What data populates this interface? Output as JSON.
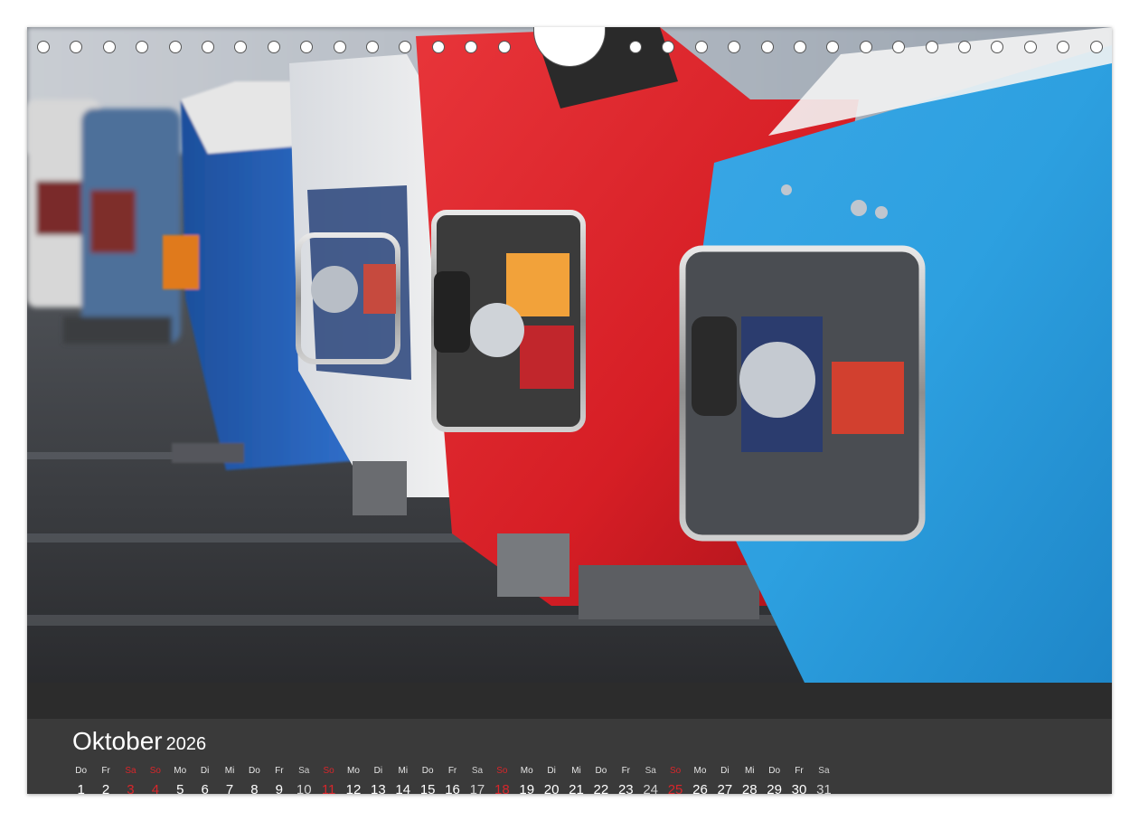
{
  "calendar": {
    "month": "Oktober",
    "year": "2026",
    "days": [
      {
        "weekday": "Do",
        "date": "1",
        "kind": "normal"
      },
      {
        "weekday": "Fr",
        "date": "2",
        "kind": "normal"
      },
      {
        "weekday": "Sa",
        "date": "3",
        "kind": "holiday"
      },
      {
        "weekday": "So",
        "date": "4",
        "kind": "holiday"
      },
      {
        "weekday": "Mo",
        "date": "5",
        "kind": "normal"
      },
      {
        "weekday": "Di",
        "date": "6",
        "kind": "normal"
      },
      {
        "weekday": "Mi",
        "date": "7",
        "kind": "normal"
      },
      {
        "weekday": "Do",
        "date": "8",
        "kind": "normal"
      },
      {
        "weekday": "Fr",
        "date": "9",
        "kind": "normal"
      },
      {
        "weekday": "Sa",
        "date": "10",
        "kind": "saturday"
      },
      {
        "weekday": "So",
        "date": "11",
        "kind": "holiday"
      },
      {
        "weekday": "Mo",
        "date": "12",
        "kind": "normal"
      },
      {
        "weekday": "Di",
        "date": "13",
        "kind": "normal"
      },
      {
        "weekday": "Mi",
        "date": "14",
        "kind": "normal"
      },
      {
        "weekday": "Do",
        "date": "15",
        "kind": "normal"
      },
      {
        "weekday": "Fr",
        "date": "16",
        "kind": "normal"
      },
      {
        "weekday": "Sa",
        "date": "17",
        "kind": "saturday"
      },
      {
        "weekday": "So",
        "date": "18",
        "kind": "holiday"
      },
      {
        "weekday": "Mo",
        "date": "19",
        "kind": "normal"
      },
      {
        "weekday": "Di",
        "date": "20",
        "kind": "normal"
      },
      {
        "weekday": "Mi",
        "date": "21",
        "kind": "normal"
      },
      {
        "weekday": "Do",
        "date": "22",
        "kind": "normal"
      },
      {
        "weekday": "Fr",
        "date": "23",
        "kind": "normal"
      },
      {
        "weekday": "Sa",
        "date": "24",
        "kind": "saturday"
      },
      {
        "weekday": "So",
        "date": "25",
        "kind": "holiday"
      },
      {
        "weekday": "Mo",
        "date": "26",
        "kind": "normal"
      },
      {
        "weekday": "Di",
        "date": "27",
        "kind": "normal"
      },
      {
        "weekday": "Mi",
        "date": "28",
        "kind": "normal"
      },
      {
        "weekday": "Do",
        "date": "29",
        "kind": "normal"
      },
      {
        "weekday": "Fr",
        "date": "30",
        "kind": "normal"
      },
      {
        "weekday": "Sa",
        "date": "31",
        "kind": "saturday"
      }
    ]
  },
  "colors": {
    "sunday_red": "#d8262b",
    "footer_band": "#2c2c2c",
    "footer_bg": "#3a3a3a"
  }
}
